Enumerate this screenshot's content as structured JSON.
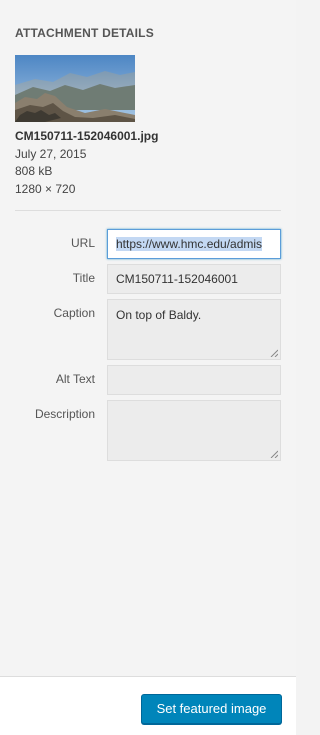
{
  "attachment": {
    "heading": "ATTACHMENT DETAILS",
    "filename": "CM150711-152046001.jpg",
    "date": "July 27, 2015",
    "filesize": "808 kB",
    "dimensions": "1280 × 720"
  },
  "fields": {
    "url": {
      "label": "URL",
      "value": "https://www.hmc.edu/admis"
    },
    "title": {
      "label": "Title",
      "value": "CM150711-152046001"
    },
    "caption": {
      "label": "Caption",
      "value": "On top of Baldy."
    },
    "alt_text": {
      "label": "Alt Text",
      "value": ""
    },
    "description": {
      "label": "Description",
      "value": ""
    }
  },
  "footer": {
    "button_label": "Set featured image"
  },
  "colors": {
    "accent": "#0085ba",
    "focus_border": "#5b9dd9",
    "selection": "#c3d8f3"
  }
}
